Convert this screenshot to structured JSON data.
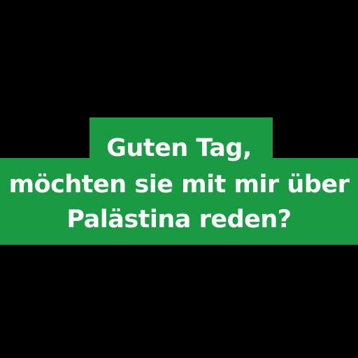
{
  "message": {
    "line1": "Guten Tag,",
    "line2": "möchten sie mit mir über",
    "line3": "Palästina reden?"
  },
  "colors": {
    "background": "#000000",
    "banner": "#1a9a43",
    "text": "#ffffff"
  }
}
